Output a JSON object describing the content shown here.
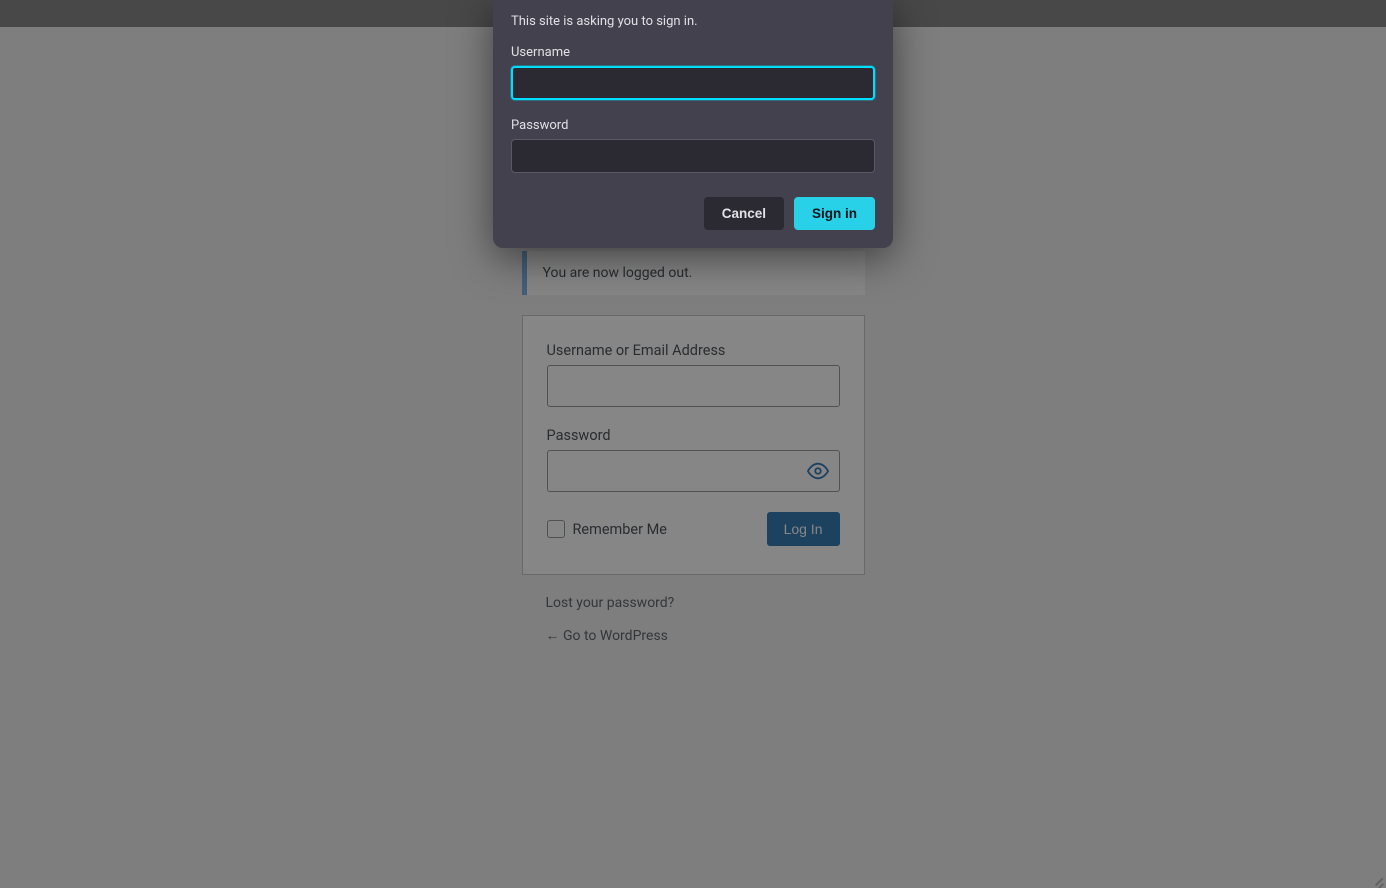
{
  "auth_dialog": {
    "prompt": "This site is asking you to sign in.",
    "username_label": "Username",
    "username_value": "",
    "password_label": "Password",
    "password_value": "",
    "cancel_label": "Cancel",
    "signin_label": "Sign in"
  },
  "notice": {
    "text": "You are now logged out."
  },
  "login_form": {
    "username_label": "Username or Email Address",
    "username_value": "",
    "password_label": "Password",
    "password_value": "",
    "remember_label": "Remember Me",
    "submit_label": "Log In"
  },
  "links": {
    "lost_password": "Lost your password?",
    "go_back": "← Go to WordPress"
  }
}
